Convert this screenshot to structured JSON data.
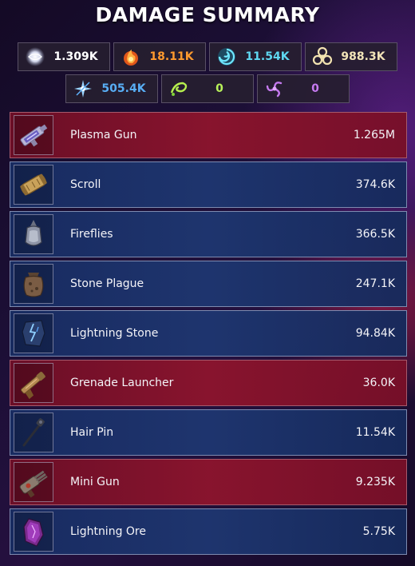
{
  "title": "DAMAGE SUMMARY",
  "damage_types": [
    {
      "icon": "light-orb-icon",
      "value": "1.309K",
      "color": "#ffffff"
    },
    {
      "icon": "fire-icon",
      "value": "18.11K",
      "color": "#ff9a2e"
    },
    {
      "icon": "water-swirl-icon",
      "value": "11.54K",
      "color": "#5fd8f2"
    },
    {
      "icon": "biohazard-icon",
      "value": "988.3K",
      "color": "#f2e4b8"
    },
    {
      "icon": "ice-burst-icon",
      "value": "505.4K",
      "color": "#58aef5"
    },
    {
      "icon": "poison-swirl-icon",
      "value": "0",
      "color": "#b8f25a"
    },
    {
      "icon": "shadow-swirl-icon",
      "value": "0",
      "color": "#c77af2"
    }
  ],
  "weapons": [
    {
      "name": "Plasma Gun",
      "damage": "1.265M",
      "tone": "red",
      "icon": "plasma-gun-icon"
    },
    {
      "name": "Scroll",
      "damage": "374.6K",
      "tone": "blue",
      "icon": "scroll-icon"
    },
    {
      "name": "Fireflies",
      "damage": "366.5K",
      "tone": "blue",
      "icon": "fireflies-lantern-icon"
    },
    {
      "name": "Stone Plague",
      "damage": "247.1K",
      "tone": "blue",
      "icon": "stone-plague-sack-icon"
    },
    {
      "name": "Lightning Stone",
      "damage": "94.84K",
      "tone": "blue",
      "icon": "lightning-stone-icon"
    },
    {
      "name": "Grenade Launcher",
      "damage": "36.0K",
      "tone": "red",
      "icon": "grenade-launcher-icon"
    },
    {
      "name": "Hair Pin",
      "damage": "11.54K",
      "tone": "blue",
      "icon": "hair-pin-icon"
    },
    {
      "name": "Mini Gun",
      "damage": "9.235K",
      "tone": "red",
      "icon": "mini-gun-icon"
    },
    {
      "name": "Lightning Ore",
      "damage": "5.75K",
      "tone": "blue",
      "icon": "lightning-ore-icon"
    }
  ]
}
